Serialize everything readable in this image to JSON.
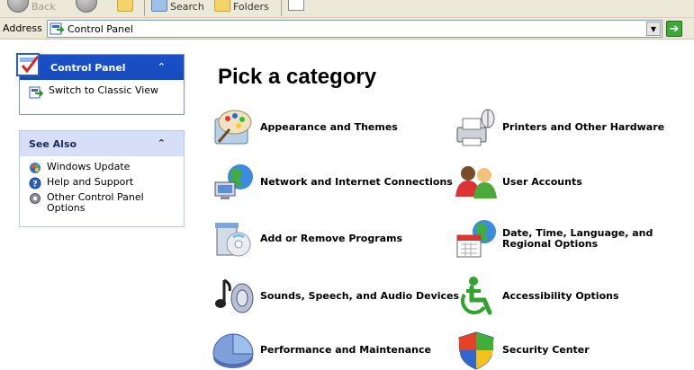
{
  "toolbar": {
    "back_label": "Back",
    "search_label": "Search",
    "folders_label": "Folders"
  },
  "address": {
    "label": "Address",
    "value": "Control Panel"
  },
  "control_panel_pane": {
    "title": "Control Panel",
    "tasks": [
      {
        "label": "Switch to Classic View"
      }
    ]
  },
  "see_also_pane": {
    "title": "See Also",
    "links": [
      {
        "label": "Windows Update"
      },
      {
        "label": "Help and Support"
      },
      {
        "label": "Other Control Panel Options"
      }
    ]
  },
  "main": {
    "heading": "Pick a category",
    "categories": [
      {
        "label": "Appearance and Themes",
        "icon": "appearance-themes-icon"
      },
      {
        "label": "Printers and Other Hardware",
        "icon": "printer-icon"
      },
      {
        "label": "Network and Internet Connections",
        "icon": "network-icon"
      },
      {
        "label": "User Accounts",
        "icon": "user-accounts-icon"
      },
      {
        "label": "Add or Remove Programs",
        "icon": "add-remove-programs-icon"
      },
      {
        "label": "Date, Time, Language, and Regional Options",
        "icon": "date-time-icon"
      },
      {
        "label": "Sounds, Speech, and Audio Devices",
        "icon": "sound-icon"
      },
      {
        "label": "Accessibility Options",
        "icon": "accessibility-icon"
      },
      {
        "label": "Performance and Maintenance",
        "icon": "performance-icon"
      },
      {
        "label": "Security Center",
        "icon": "security-shield-icon"
      }
    ]
  },
  "colors": {
    "pane_header_blue": "#1c50c8",
    "pane_header_light": "#d6dff7",
    "chrome": "#ece9d8"
  }
}
